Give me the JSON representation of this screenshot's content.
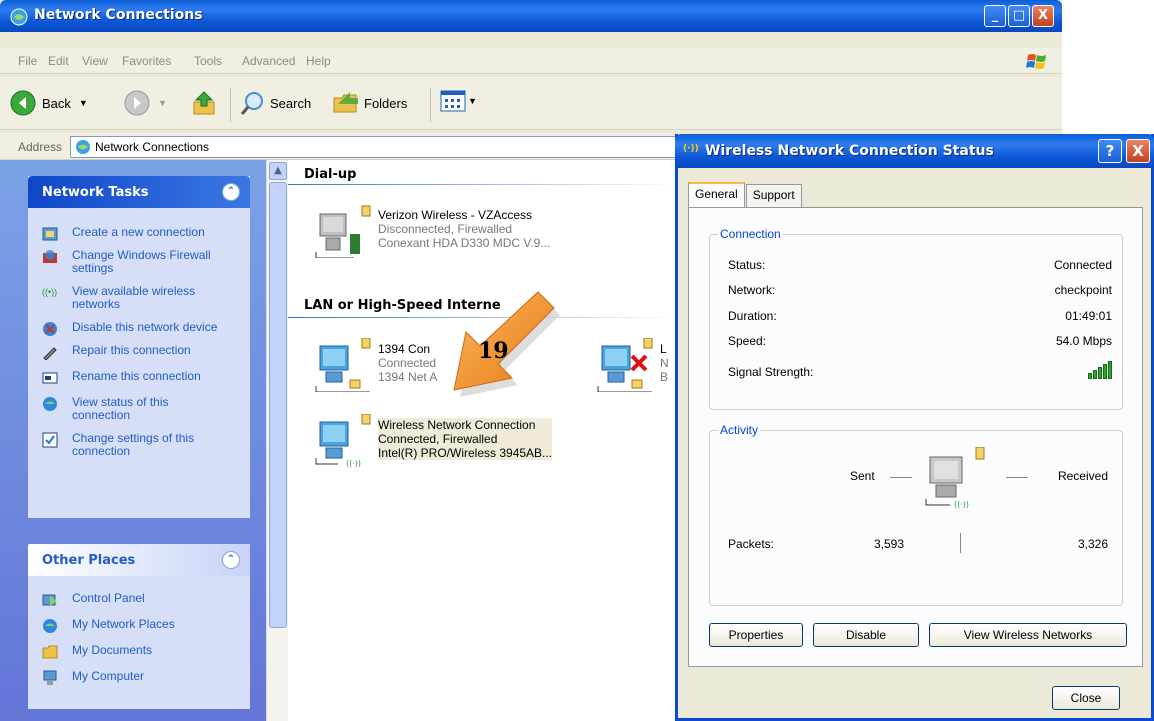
{
  "main_window": {
    "title": "Network Connections",
    "menu": [
      "File",
      "Edit",
      "View",
      "Favorites",
      "Tools",
      "Advanced",
      "Help"
    ],
    "toolbar": {
      "back": "Back",
      "search": "Search",
      "folders": "Folders"
    },
    "address": {
      "label": "Address",
      "value": "Network Connections"
    }
  },
  "task_pane": {
    "network_tasks": {
      "title": "Network Tasks",
      "items": [
        "Create a new connection",
        "Change Windows Firewall settings",
        "View available wireless networks",
        "Disable this network device",
        "Repair this connection",
        "Rename this connection",
        "View status of this connection",
        "Change settings of this connection"
      ]
    },
    "other_places": {
      "title": "Other Places",
      "items": [
        "Control Panel",
        "My Network Places",
        "My Documents",
        "My Computer"
      ]
    }
  },
  "content": {
    "groups": {
      "dialup": "Dial-up",
      "lan": "LAN or High-Speed Interne"
    },
    "connections": {
      "verizon": {
        "name": "Verizon Wireless - VZAccess",
        "status": "Disconnected, Firewalled",
        "device": "Conexant HDA D330 MDC V.9..."
      },
      "net1394": {
        "name": "1394 Con",
        "status": "Connected",
        "device": "1394 Net A",
        "status_tail": "ed"
      },
      "lan_partial": {
        "name": "L",
        "status": "N",
        "device": "B"
      },
      "wireless": {
        "name": "Wireless Network Connection",
        "status": "Connected, Firewalled",
        "device": "Intel(R) PRO/Wireless 3945AB..."
      }
    },
    "annotation_number": "19"
  },
  "status_dialog": {
    "title": "Wireless Network Connection Status",
    "wifi_glyph": "(·))",
    "help_label": "?",
    "close_x": "X",
    "tabs": [
      "General",
      "Support"
    ],
    "connection": {
      "title": "Connection",
      "status_label": "Status:",
      "status_value": "Connected",
      "network_label": "Network:",
      "network_value": "checkpoint",
      "duration_label": "Duration:",
      "duration_value": "01:49:01",
      "speed_label": "Speed:",
      "speed_value": "54.0 Mbps",
      "signal_label": "Signal Strength:",
      "signal_bars": 5
    },
    "activity": {
      "title": "Activity",
      "sent_label": "Sent",
      "received_label": "Received",
      "packets_label": "Packets:",
      "packets_sent": "3,593",
      "packets_received": "3,326"
    },
    "buttons": {
      "properties": "Properties",
      "disable": "Disable",
      "view_wireless": "View Wireless Networks",
      "close": "Close"
    }
  },
  "colors": {
    "title_blue": "#0b55d4",
    "link_blue": "#215dc6",
    "annotation_orange": "#f28c28"
  }
}
